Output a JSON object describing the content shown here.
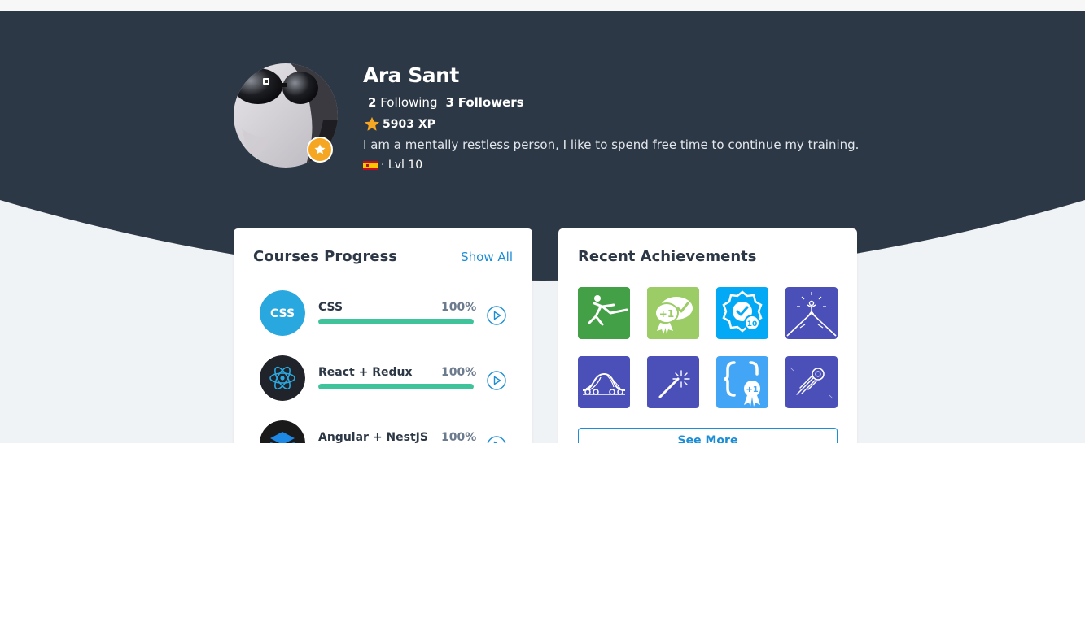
{
  "profile": {
    "name": "Ara Sant",
    "following_count": "2",
    "following_label": "Following",
    "followers_count": "3",
    "followers_label": "Followers",
    "xp": "5903 XP",
    "bio": "I am a mentally restless person, I like to spend free time to continue my training.",
    "level": "· Lvl 10",
    "flag": "spain-flag-icon"
  },
  "courses": {
    "title": "Courses Progress",
    "show_all": "Show All",
    "items": [
      {
        "name": "CSS",
        "percent": "100%",
        "progress": 1.0,
        "icon": "css-icon",
        "icon_text": "CSS"
      },
      {
        "name": "React + Redux",
        "percent": "100%",
        "progress": 1.0,
        "icon": "react-icon"
      },
      {
        "name": "Angular + NestJS",
        "percent": "100%",
        "progress": 1.0,
        "icon": "nestjs-icon"
      }
    ]
  },
  "achievements": {
    "title": "Recent Achievements",
    "see_more": "See More",
    "items": [
      {
        "icon": "skier-badge-icon",
        "color": "#43a047"
      },
      {
        "icon": "chat-plus-one-badge-icon",
        "color": "#9ccc65",
        "text": "+1"
      },
      {
        "icon": "ten-checks-badge-icon",
        "color": "#03a9f4",
        "text": "10"
      },
      {
        "icon": "mountain-summit-badge-icon",
        "color": "#4b4fb8"
      },
      {
        "icon": "rollercoaster-badge-icon",
        "color": "#4b4fb8"
      },
      {
        "icon": "magic-wand-badge-icon",
        "color": "#4b4fb8"
      },
      {
        "icon": "code-plus-one-badge-icon",
        "color": "#42a5f5",
        "text": "+1"
      },
      {
        "icon": "comet-badge-icon",
        "color": "#4b4fb8"
      }
    ]
  },
  "colors": {
    "hero": "#2d3846",
    "accent": "#1c8ed6",
    "progress": "#3ec39b",
    "star": "#f5a623"
  }
}
